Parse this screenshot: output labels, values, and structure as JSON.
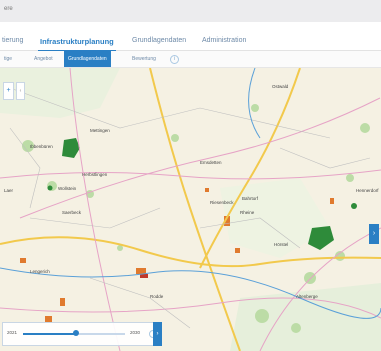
{
  "window": {
    "title": "ere"
  },
  "tabs": [
    {
      "label": "tierung",
      "active": false
    },
    {
      "label": "Infrastrukturplanung",
      "active": true
    },
    {
      "label": "Grundlagendaten",
      "active": false
    },
    {
      "label": "Administration",
      "active": false
    }
  ],
  "subtabs": [
    {
      "label": "tige",
      "active": false
    },
    {
      "label": "Angebot",
      "active": false
    },
    {
      "label": "Grundlagendaten",
      "active": true
    },
    {
      "label": "Bewertung",
      "active": false
    }
  ],
  "map": {
    "places": [
      "Ostwald",
      "Ibbenbüren",
      "Herbstlingen",
      "Wollstein",
      "Laer",
      "Emsdetten",
      "Saerbeck",
      "Rheine",
      "Lengerich",
      "Hörstel",
      "Bahrtorf",
      "Rodde",
      "Hennerdorf",
      "Altenberge",
      "Riesenbeck",
      "Mettingen"
    ],
    "colors": {
      "ui_accent": "#2a7fc4",
      "forest": "#2e8b3a",
      "built_up": "#e07a2e",
      "road_major": "#f2c94c",
      "water": "#5aa0d8"
    }
  },
  "timeline": {
    "start_label": "2021",
    "end_label": "2030",
    "play_icon": "chevron-right-icon",
    "progress": 0.52
  }
}
